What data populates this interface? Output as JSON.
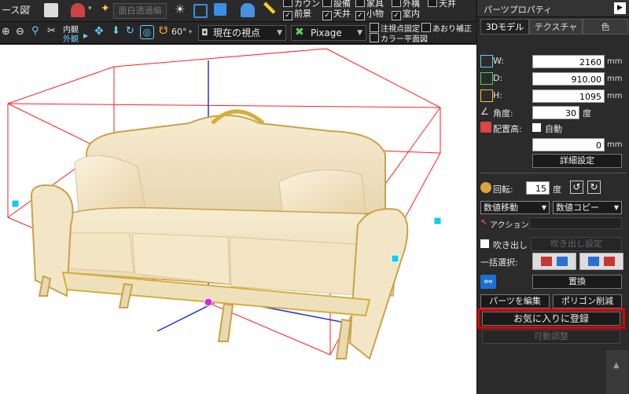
{
  "toolbar": {
    "perspective_label": "ース図",
    "faded_button_label": "面白透過編",
    "inner_view": "内観",
    "outer_view": "外観",
    "angle": "60°",
    "viewpoint_select": "現在の視点",
    "pixage_label": "Pixage",
    "checks_row1": [
      {
        "label": "カウント",
        "checked": false
      },
      {
        "label": "設備",
        "checked": false
      },
      {
        "label": "家具",
        "checked": false
      },
      {
        "label": "外構",
        "checked": false
      },
      {
        "label": "天井",
        "checked": false
      }
    ],
    "checks_row2": [
      {
        "label": "前景",
        "checked": true
      },
      {
        "label": "天井",
        "checked": true
      },
      {
        "label": "小物",
        "checked": true
      },
      {
        "label": "室内",
        "checked": true
      }
    ],
    "note_point_fixed": "注視点固定",
    "color_plan": "カラー平面図",
    "tilt_correction": "あおり補正"
  },
  "panel": {
    "title": "パーツプロパティ",
    "tabs": [
      "3Dモデル",
      "テクスチャ",
      "色"
    ],
    "w_label": "W:",
    "w_value": "2160",
    "d_label": "D:",
    "d_value": "910.00",
    "h_label": "H:",
    "h_value": "1095",
    "unit": "mm",
    "angle_label": "角度:",
    "angle_value": "30",
    "angle_unit": "度",
    "placement_label": "配置高:",
    "auto_label": "自動",
    "placement_value": "0",
    "detail_button": "詳細設定",
    "rotation_label": "回転:",
    "rotation_value": "15",
    "rotation_unit": "度",
    "move_select": "数値移動",
    "copy_select": "数値コピー",
    "action_label": "アクション:",
    "balloon_label": "吹き出し",
    "balloon_settings": "吹き出し設定",
    "bulk_select_label": "一括選択:",
    "replace_button": "置換",
    "edit_parts_button": "パーツを編集",
    "polygon_reduce_button": "ポリゴン削減",
    "favorite_button": "お気に入りに登録",
    "movable_adjust_button": "可動調整"
  },
  "colors": {
    "highlight": "#e00000",
    "bbox": "#ff2020",
    "axis": "#2233dd"
  }
}
